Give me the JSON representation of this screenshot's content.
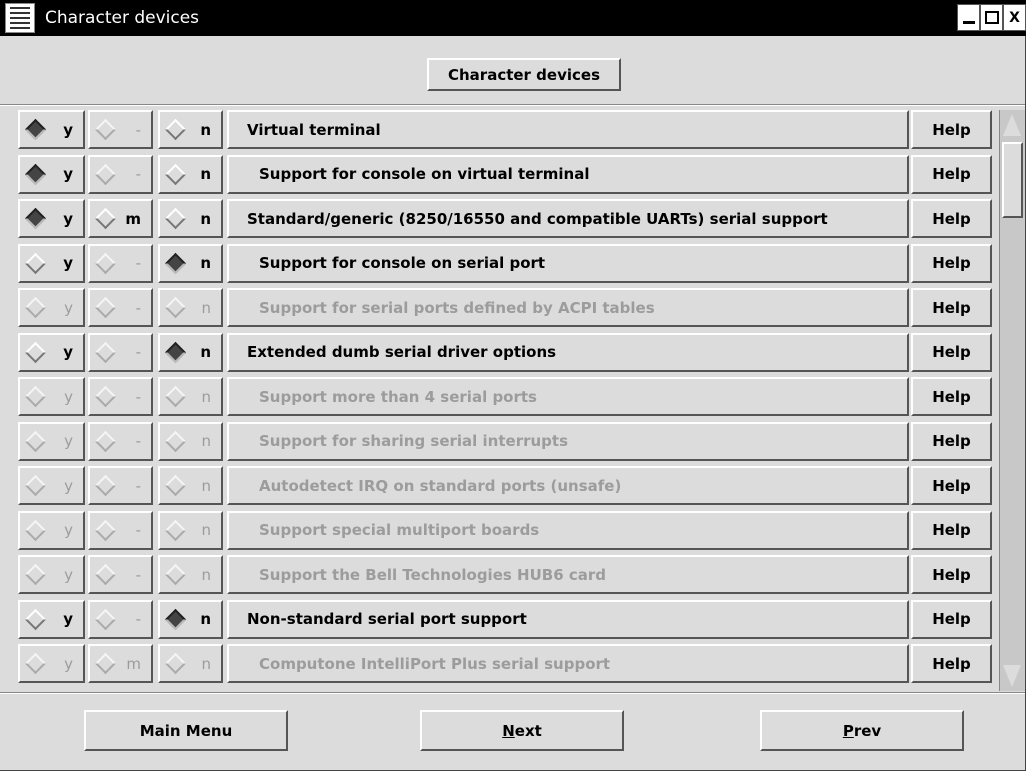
{
  "window": {
    "title": "Character devices",
    "menu_icon": "window-menu-icon",
    "controls": [
      "minimize-icon",
      "maximize-icon",
      "close-icon"
    ]
  },
  "header": {
    "button_label": "Character devices"
  },
  "choice_labels": {
    "y": "y",
    "m": "m",
    "n": "n",
    "dash": "-"
  },
  "options": [
    {
      "label": "Virtual terminal",
      "indent": false,
      "enabled": true,
      "has_m": false,
      "selected": "y",
      "help": "Help"
    },
    {
      "label": "Support for console on virtual terminal",
      "indent": true,
      "enabled": true,
      "has_m": false,
      "selected": "y",
      "help": "Help"
    },
    {
      "label": "Standard/generic (8250/16550 and compatible UARTs) serial support",
      "indent": false,
      "enabled": true,
      "has_m": true,
      "selected": "y",
      "help": "Help"
    },
    {
      "label": "Support for console on serial port",
      "indent": true,
      "enabled": true,
      "has_m": false,
      "selected": "n",
      "help": "Help"
    },
    {
      "label": "Support for serial ports defined by ACPI tables",
      "indent": true,
      "enabled": false,
      "has_m": false,
      "selected": null,
      "help": "Help"
    },
    {
      "label": "Extended dumb serial driver options",
      "indent": false,
      "enabled": true,
      "has_m": false,
      "selected": "n",
      "help": "Help"
    },
    {
      "label": "Support more than 4 serial ports",
      "indent": true,
      "enabled": false,
      "has_m": false,
      "selected": null,
      "help": "Help"
    },
    {
      "label": "Support for sharing serial interrupts",
      "indent": true,
      "enabled": false,
      "has_m": false,
      "selected": null,
      "help": "Help"
    },
    {
      "label": "Autodetect IRQ on standard ports (unsafe)",
      "indent": true,
      "enabled": false,
      "has_m": false,
      "selected": null,
      "help": "Help"
    },
    {
      "label": "Support special multiport boards",
      "indent": true,
      "enabled": false,
      "has_m": false,
      "selected": null,
      "help": "Help"
    },
    {
      "label": "Support the Bell Technologies HUB6 card",
      "indent": true,
      "enabled": false,
      "has_m": false,
      "selected": null,
      "help": "Help"
    },
    {
      "label": "Non-standard serial port support",
      "indent": false,
      "enabled": true,
      "has_m": false,
      "selected": "n",
      "help": "Help"
    },
    {
      "label": "Computone IntelliPort Plus serial support",
      "indent": true,
      "enabled": false,
      "has_m": true,
      "selected": null,
      "help": "Help"
    }
  ],
  "footer": {
    "main_menu": "Main Menu",
    "next_mnemonic": "N",
    "next_rest": "ext",
    "prev_mnemonic": "P",
    "prev_rest": "rev"
  }
}
